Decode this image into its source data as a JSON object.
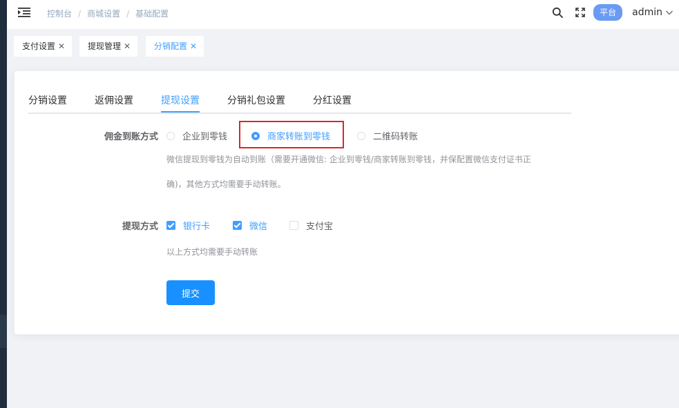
{
  "breadcrumb": {
    "items": [
      "控制台",
      "商城设置",
      "基础配置"
    ],
    "separator": "/"
  },
  "header": {
    "platform_badge": "平台",
    "user_name": "admin",
    "icons": [
      "hamburger-icon",
      "search-icon",
      "fullscreen-icon",
      "chevron-down-icon"
    ]
  },
  "tags": [
    {
      "label": "支付设置",
      "active": false
    },
    {
      "label": "提现管理",
      "active": false
    },
    {
      "label": "分销配置",
      "active": true
    }
  ],
  "tabs": [
    {
      "label": "分销设置",
      "active": false
    },
    {
      "label": "返佣设置",
      "active": false
    },
    {
      "label": "提现设置",
      "active": true
    },
    {
      "label": "分销礼包设置",
      "active": false
    },
    {
      "label": "分红设置",
      "active": false
    }
  ],
  "form": {
    "commission_label": "佣金到账方式",
    "commission_options": [
      {
        "label": "企业到零钱",
        "checked": false
      },
      {
        "label": "商家转账到零钱",
        "checked": true
      },
      {
        "label": "二维码转账",
        "checked": false
      }
    ],
    "commission_hint_line1": "微信提现到零钱为自动到账（需要开通微信: 企业到零钱/商家转账到零钱，并保配置微信支付证书正",
    "commission_hint_line2": "确)，其他方式均需要手动转账。",
    "withdraw_label": "提现方式",
    "withdraw_options": [
      {
        "label": "银行卡",
        "checked": true
      },
      {
        "label": "微信",
        "checked": true
      },
      {
        "label": "支付宝",
        "checked": false
      }
    ],
    "withdraw_hint": "以上方式均需要手动转账",
    "submit_label": "提交"
  },
  "colors": {
    "primary": "#409eff",
    "button": "#1890ff",
    "highlight_border": "#d9252b",
    "badge": "#6a9bf4"
  }
}
